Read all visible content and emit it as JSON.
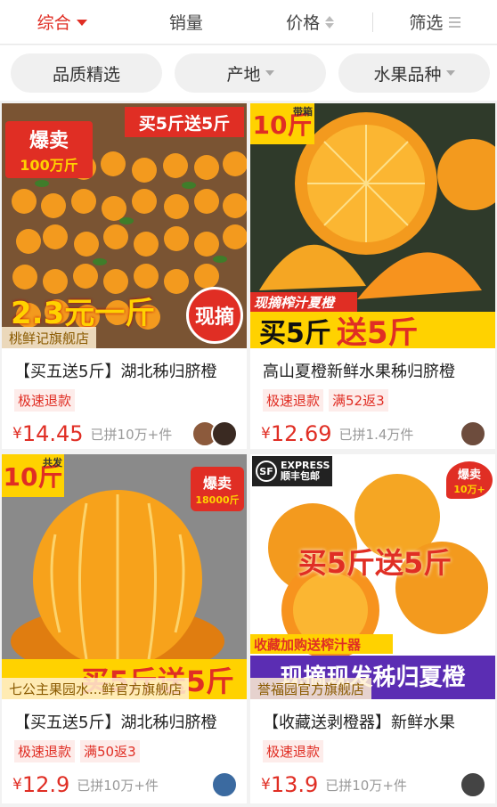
{
  "sortbar": {
    "items": [
      {
        "label": "综合",
        "active": true
      },
      {
        "label": "销量"
      },
      {
        "label": "价格"
      },
      {
        "label": "筛选"
      }
    ]
  },
  "filters": {
    "chips": [
      {
        "label": "品质精选"
      },
      {
        "label": "产地"
      },
      {
        "label": "水果品种"
      }
    ]
  },
  "products": [
    {
      "shop": "桃鲜记旗舰店",
      "title": "【买五送5斤】湖北秭归脐橙",
      "tags": [
        "极速退款"
      ],
      "yen": "¥",
      "price": "14.45",
      "sold": "已拼10万+件",
      "banner_top": "买5斤送5斤",
      "badge": "爆卖",
      "badge2": "100万斤",
      "bottom_text": "2.3元一斤",
      "stamp": "现摘"
    },
    {
      "shop": "",
      "title": "高山夏橙新鲜水果秭归脐橙",
      "tags": [
        "极速退款",
        "满52返3"
      ],
      "yen": "¥",
      "price": "12.69",
      "sold": "已拼1.4万件",
      "corner_big": "10斤",
      "corner_small": "带箱",
      "ribbon": "现摘榨汁夏橙",
      "bottom_a": "买5斤",
      "bottom_b": "送5斤"
    },
    {
      "shop": "七公主果园水...鲜官方旗舰店",
      "title": "【买五送5斤】湖北秭归脐橙",
      "tags": [
        "极速退款",
        "满50返3"
      ],
      "yen": "¥",
      "price": "12.9",
      "sold": "已拼10万+件",
      "corner_big": "10斤",
      "corner_small": "共发",
      "badge": "爆卖",
      "badge2": "18000斤",
      "bottom_text": "买5斤送5斤"
    },
    {
      "shop": "誉福园官方旗舰店",
      "title": "【收藏送剥橙器】新鲜水果",
      "tags": [
        "极速退款"
      ],
      "yen": "¥",
      "price": "13.9",
      "sold": "已拼10万+件",
      "express_en": "EXPRESS",
      "express_cn": "顺丰包邮",
      "sf": "SF",
      "badge": "爆卖",
      "badge2": "10万+",
      "banner_mid": "买5斤送5斤",
      "ribbon": "收藏加购送榨汁器",
      "bottom_text": "现摘现发秭归夏橙"
    }
  ],
  "colors": {
    "accent": "#e02e24",
    "orange": "#f7931e",
    "yellow": "#ffd200"
  }
}
